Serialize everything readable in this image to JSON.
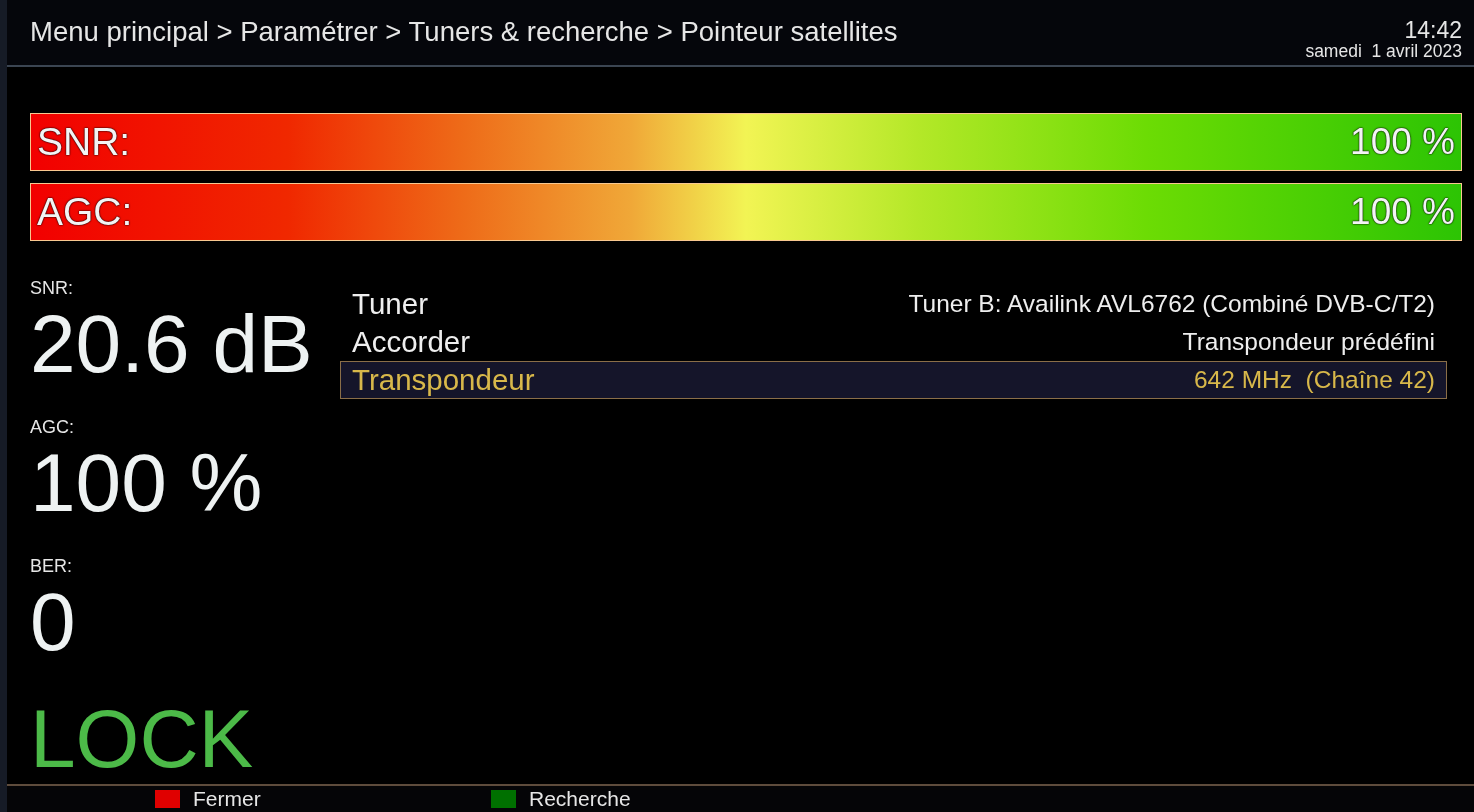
{
  "header": {
    "breadcrumb": "Menu principal > Paramétrer > Tuners & recherche > Pointeur satellites",
    "time": "14:42",
    "date": "samedi  1 avril 2023"
  },
  "meters": [
    {
      "label": "SNR:",
      "level": 1,
      "reading": "100 %"
    },
    {
      "label": "AGC:",
      "level": 1,
      "reading": "100 %"
    }
  ],
  "readouts": [
    {
      "label": "SNR:",
      "value": "20.6 dB"
    },
    {
      "label": "AGC:",
      "value": "100 %"
    },
    {
      "label": "BER:",
      "value": "0"
    }
  ],
  "lock_status": "LOCK",
  "settings": [
    {
      "label": "Tuner",
      "value": "Tuner B: Availink AVL6762 (Combiné DVB-C/T2)",
      "selected": false
    },
    {
      "label": "Accorder",
      "value": "Transpondeur prédéfini",
      "selected": false
    },
    {
      "label": "Transpondeur",
      "value": "642 MHz  (Chaîne 42)",
      "selected": true
    }
  ],
  "footer": {
    "buttons": [
      {
        "label": "Fermer",
        "color": "#e00000"
      },
      {
        "label": "Recherche",
        "color": "#007000"
      }
    ]
  }
}
